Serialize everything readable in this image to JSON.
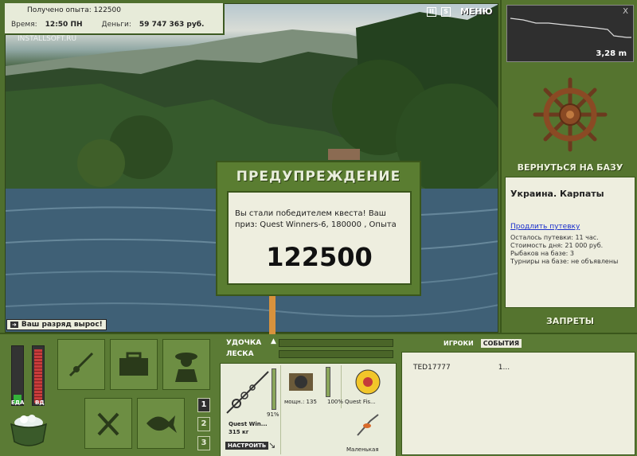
{
  "status": {
    "experience_label": "Получено опыта:",
    "experience_value": "122500",
    "time_label": "Время:",
    "time_value": "12:50 ПН",
    "money_label": "Деньги:",
    "money_value": "59 747 363 руб."
  },
  "watermark": "INSTALLSOFT.RU",
  "top_controls": {
    "pause_icon": "pause-icon",
    "s_label": "S",
    "menu_label": "МЕНЮ"
  },
  "rank_badge": "Ваш разряд вырос!",
  "modal": {
    "title": "ПРЕДУПРЕЖДЕНИЕ",
    "message": "Вы стали победителем квеста! Ваш приз: Quest Winners-6, 180000 , Опыта",
    "value": "122500"
  },
  "right_panel": {
    "depth_close": "X",
    "depth_value": "3,28 m",
    "return_label": "ВЕРНУТЬСЯ НА БАЗУ",
    "location_title": "Украина. Карпаты",
    "extend_link": "Продлить путевку",
    "lines": [
      "Осталось путевки: 11 час.",
      "Стоимость дня: 21 000 руб.",
      "Рыбаков на базе: 3",
      "Турниры на базе: не объявлены"
    ],
    "bans_label": "ЗАПРЕТЫ"
  },
  "bottom": {
    "food_label": "ЕДА",
    "vd_label": "ВД",
    "food_level": 0.15,
    "vd_level": 0.95,
    "num_buttons": [
      "1",
      "2",
      "3"
    ]
  },
  "tackle": {
    "rod_label": "УДОЧКА",
    "line_label": "ЛЕСКА",
    "rod_percent": "91%",
    "rod_name": "Quest Win...",
    "rod_weight": "315 кг",
    "setup_button": "НАСТРОИТЬ",
    "reel_power": "мощн.: 135",
    "reel_percent": "100%",
    "line_name": "Quest Fis...",
    "lure_name": "Маленькая"
  },
  "events": {
    "tab_players": "ИГРОКИ",
    "tab_events": "СОБЫТИЯ",
    "rows": [
      {
        "name": "TED17777",
        "value": "1..."
      }
    ]
  },
  "colors": {
    "panel_green": "#5b7b35",
    "paper": "#eeeedf",
    "accent_orange": "#d8923d"
  }
}
